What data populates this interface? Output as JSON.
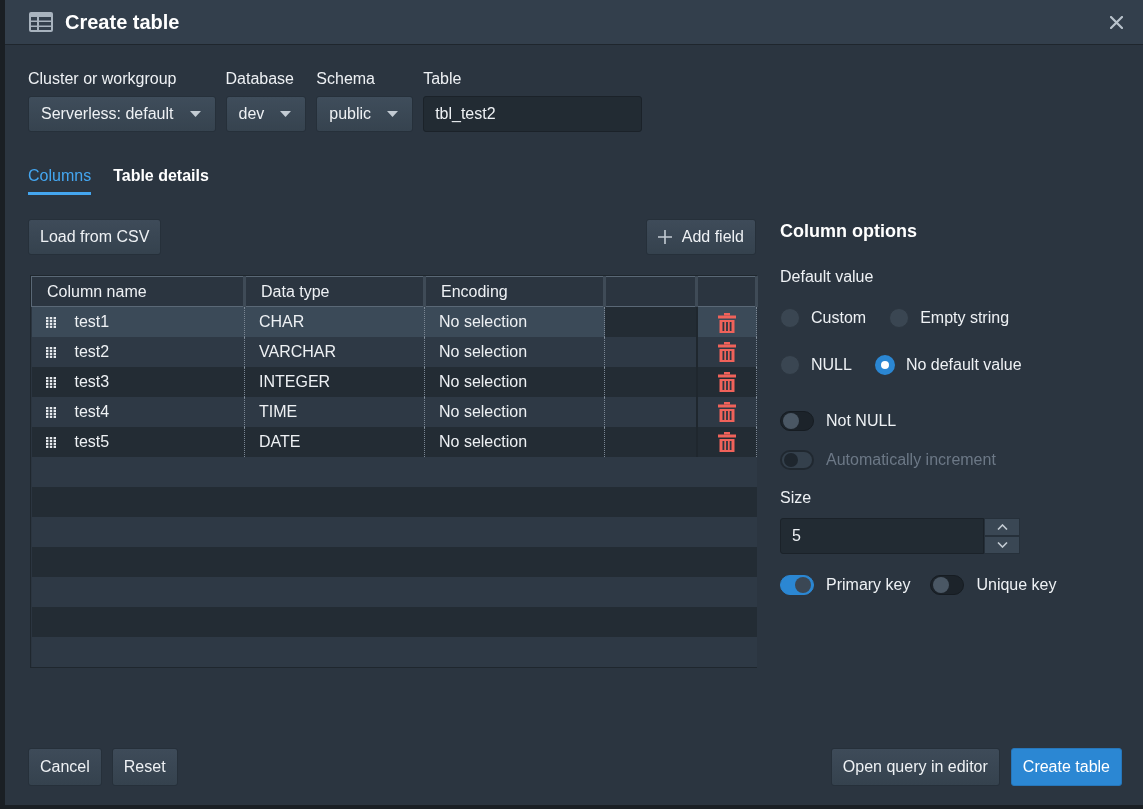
{
  "dialog": {
    "title": "Create table"
  },
  "fields": [
    {
      "kind": "select",
      "label": "Cluster or workgroup",
      "value": "Serverless: default"
    },
    {
      "kind": "select",
      "label": "Database",
      "value": "dev"
    },
    {
      "kind": "select",
      "label": "Schema",
      "value": "public"
    },
    {
      "kind": "input",
      "label": "Table",
      "value": "tbl_test2"
    }
  ],
  "tabs": [
    {
      "label": "Columns",
      "selected": true
    },
    {
      "label": "Table details",
      "selected": false
    }
  ],
  "toolbar": {
    "load_button": "Load from CSV",
    "add_button": "Add field"
  },
  "table": {
    "columns": [
      "Column name",
      "Data type",
      "Encoding"
    ],
    "rows": [
      {
        "name": "test1",
        "data_type": "CHAR",
        "encoding": "No selection",
        "selected": true
      },
      {
        "name": "test2",
        "data_type": "VARCHAR",
        "encoding": "No selection",
        "selected": false
      },
      {
        "name": "test3",
        "data_type": "INTEGER",
        "encoding": "No selection",
        "selected": false
      },
      {
        "name": "test4",
        "data_type": "TIME",
        "encoding": "No selection",
        "selected": false
      },
      {
        "name": "test5",
        "data_type": "DATE",
        "encoding": "No selection",
        "selected": false
      }
    ]
  },
  "column_options": {
    "title": "Column options",
    "default_value": {
      "label": "Default value",
      "options": [
        {
          "label": "Custom",
          "selected": false
        },
        {
          "label": "Empty string",
          "selected": false
        },
        {
          "label": "NULL",
          "selected": false
        },
        {
          "label": "No default value",
          "selected": true
        }
      ]
    },
    "toggles": [
      {
        "label": "Not NULL",
        "on": false,
        "disabled": false
      },
      {
        "label": "Automatically increment",
        "on": false,
        "disabled": true
      }
    ],
    "size": {
      "label": "Size",
      "value": "5"
    },
    "keys": [
      {
        "label": "Primary key",
        "on": true
      },
      {
        "label": "Unique key",
        "on": false
      }
    ]
  },
  "footer": {
    "left_buttons": [
      "Cancel",
      "Reset"
    ],
    "right_buttons": [
      {
        "label": "Open query in editor",
        "primary": false
      },
      {
        "label": "Create table",
        "primary": true
      }
    ]
  }
}
